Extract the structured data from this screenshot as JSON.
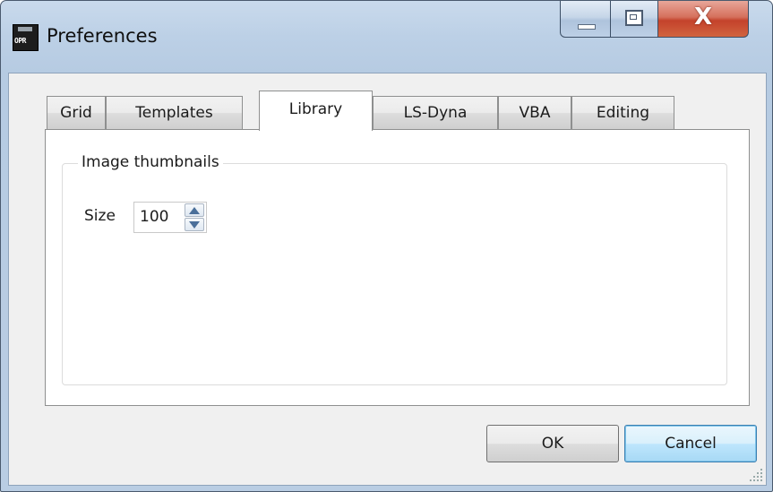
{
  "window": {
    "title": "Preferences",
    "icon_text": "OPR",
    "controls": {
      "minimize": "minimize-icon",
      "maximize": "maximize-icon",
      "close_glyph": "X"
    }
  },
  "tabs": [
    {
      "label": "Grid",
      "active": false
    },
    {
      "label": "Templates",
      "active": false
    },
    {
      "label": "Library",
      "active": true
    },
    {
      "label": "LS-Dyna",
      "active": false
    },
    {
      "label": "VBA",
      "active": false
    },
    {
      "label": "Editing",
      "active": false
    }
  ],
  "library": {
    "group_title": "Image thumbnails",
    "size_label": "Size",
    "size_value": "100"
  },
  "buttons": {
    "ok": "OK",
    "cancel": "Cancel"
  },
  "colors": {
    "close_red": "#c4422b",
    "accent_blue": "#3c7fb1"
  }
}
